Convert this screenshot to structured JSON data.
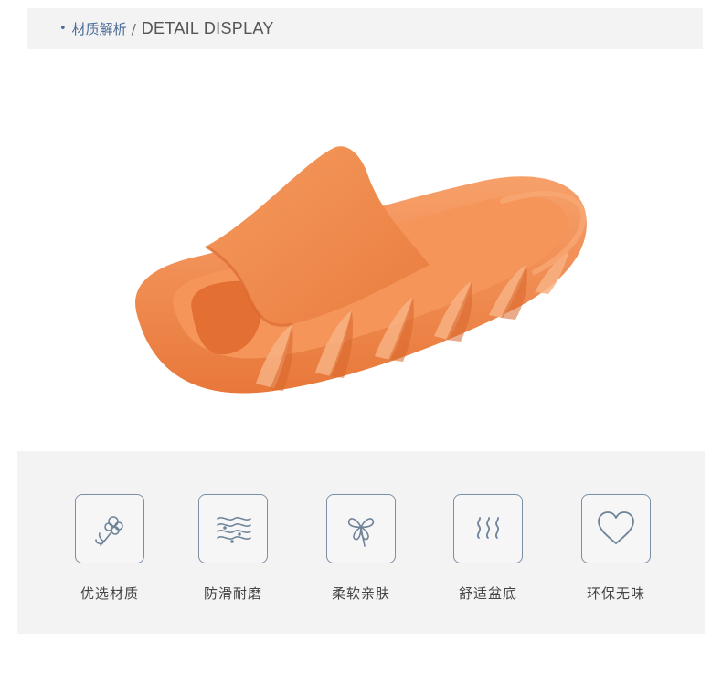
{
  "header": {
    "bullet": "•",
    "title_cn": "材质解析",
    "separator": "/",
    "title_en": "DETAIL DISPLAY"
  },
  "product": {
    "name": "slide-sandal",
    "color": "#f08a4b"
  },
  "features": [
    {
      "label": "优选材质",
      "icon": "cotton-flower-icon"
    },
    {
      "label": "防滑耐磨",
      "icon": "wave-lines-icon"
    },
    {
      "label": "柔软亲肤",
      "icon": "clover-icon"
    },
    {
      "label": "舒适盆底",
      "icon": "steam-icon"
    },
    {
      "label": "环保无味",
      "icon": "heart-icon"
    }
  ],
  "colors": {
    "accent": "#4a6b97",
    "icon_stroke": "#6f8399",
    "panel_bg": "#f3f3f3"
  }
}
